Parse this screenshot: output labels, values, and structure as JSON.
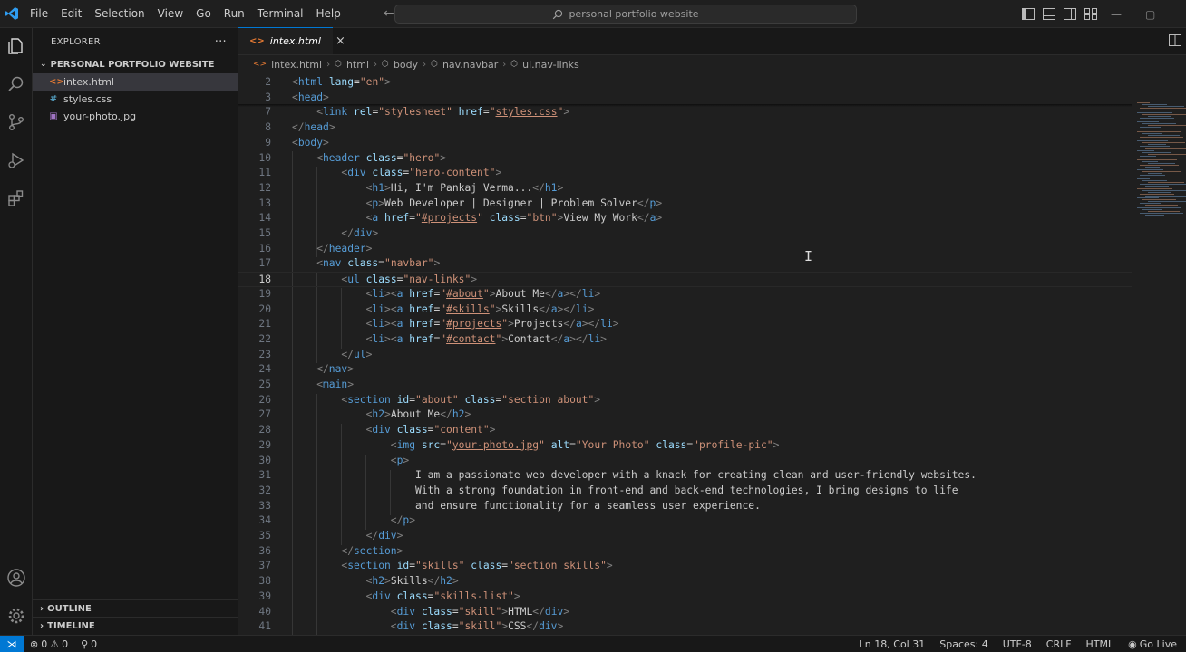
{
  "titlebar": {
    "menu": [
      "File",
      "Edit",
      "Selection",
      "View",
      "Go",
      "Run",
      "Terminal",
      "Help"
    ],
    "search_text": "personal portfolio website",
    "accent": "#0078d4"
  },
  "sidebar": {
    "title": "EXPLORER",
    "more": "···",
    "folder": "PERSONAL PORTFOLIO WEBSITE",
    "files": [
      {
        "name": "intex.html",
        "icon": "<>",
        "icon_color": "#e37933",
        "active": true
      },
      {
        "name": "styles.css",
        "icon": "#",
        "icon_color": "#519aba",
        "active": false
      },
      {
        "name": "your-photo.jpg",
        "icon": "▣",
        "icon_color": "#a074c4",
        "active": false
      }
    ],
    "sections": [
      "OUTLINE",
      "TIMELINE"
    ]
  },
  "editor": {
    "tab": {
      "label": "intex.html",
      "close": "×"
    },
    "breadcrumb": [
      "intex.html",
      "html",
      "body",
      "nav.navbar",
      "ul.nav-links"
    ],
    "current_line": "18",
    "lines": [
      {
        "n": "2",
        "i": 0,
        "t": [
          [
            "b",
            "<"
          ],
          [
            "t",
            "html"
          ],
          [
            "a",
            " lang"
          ],
          [
            "x",
            "="
          ],
          [
            "s",
            "\"en\""
          ],
          [
            "b",
            ">"
          ]
        ]
      },
      {
        "n": "3",
        "i": 0,
        "t": [
          [
            "b",
            "<"
          ],
          [
            "t",
            "head"
          ],
          [
            "b",
            ">"
          ]
        ]
      },
      {
        "n": "7",
        "i": 1,
        "t": [
          [
            "b",
            "<"
          ],
          [
            "t",
            "link"
          ],
          [
            "a",
            " rel"
          ],
          [
            "x",
            "="
          ],
          [
            "s",
            "\"stylesheet\""
          ],
          [
            "a",
            " href"
          ],
          [
            "x",
            "="
          ],
          [
            "s",
            "\""
          ],
          [
            "su",
            "styles.css"
          ],
          [
            "s",
            "\""
          ],
          [
            "b",
            ">"
          ]
        ]
      },
      {
        "n": "8",
        "i": 0,
        "t": [
          [
            "b",
            "</"
          ],
          [
            "t",
            "head"
          ],
          [
            "b",
            ">"
          ]
        ]
      },
      {
        "n": "9",
        "i": 0,
        "t": [
          [
            "b",
            "<"
          ],
          [
            "t",
            "body"
          ],
          [
            "b",
            ">"
          ]
        ]
      },
      {
        "n": "10",
        "i": 1,
        "t": [
          [
            "b",
            "<"
          ],
          [
            "t",
            "header"
          ],
          [
            "a",
            " class"
          ],
          [
            "x",
            "="
          ],
          [
            "s",
            "\"hero\""
          ],
          [
            "b",
            ">"
          ]
        ]
      },
      {
        "n": "11",
        "i": 2,
        "t": [
          [
            "b",
            "<"
          ],
          [
            "t",
            "div"
          ],
          [
            "a",
            " class"
          ],
          [
            "x",
            "="
          ],
          [
            "s",
            "\"hero-content\""
          ],
          [
            "b",
            ">"
          ]
        ]
      },
      {
        "n": "12",
        "i": 3,
        "t": [
          [
            "b",
            "<"
          ],
          [
            "t",
            "h1"
          ],
          [
            "b",
            ">"
          ],
          [
            "x",
            "Hi, I'm Pankaj Verma..."
          ],
          [
            "b",
            "</"
          ],
          [
            "t",
            "h1"
          ],
          [
            "b",
            ">"
          ]
        ]
      },
      {
        "n": "13",
        "i": 3,
        "t": [
          [
            "b",
            "<"
          ],
          [
            "t",
            "p"
          ],
          [
            "b",
            ">"
          ],
          [
            "x",
            "Web Developer | Designer | Problem Solver"
          ],
          [
            "b",
            "</"
          ],
          [
            "t",
            "p"
          ],
          [
            "b",
            ">"
          ]
        ]
      },
      {
        "n": "14",
        "i": 3,
        "t": [
          [
            "b",
            "<"
          ],
          [
            "t",
            "a"
          ],
          [
            "a",
            " href"
          ],
          [
            "x",
            "="
          ],
          [
            "s",
            "\""
          ],
          [
            "su",
            "#projects"
          ],
          [
            "s",
            "\""
          ],
          [
            "a",
            " class"
          ],
          [
            "x",
            "="
          ],
          [
            "s",
            "\"btn\""
          ],
          [
            "b",
            ">"
          ],
          [
            "x",
            "View My Work"
          ],
          [
            "b",
            "</"
          ],
          [
            "t",
            "a"
          ],
          [
            "b",
            ">"
          ]
        ]
      },
      {
        "n": "15",
        "i": 2,
        "t": [
          [
            "b",
            "</"
          ],
          [
            "t",
            "div"
          ],
          [
            "b",
            ">"
          ]
        ]
      },
      {
        "n": "16",
        "i": 1,
        "t": [
          [
            "b",
            "</"
          ],
          [
            "t",
            "header"
          ],
          [
            "b",
            ">"
          ]
        ]
      },
      {
        "n": "17",
        "i": 1,
        "t": [
          [
            "b",
            "<"
          ],
          [
            "t",
            "nav"
          ],
          [
            "a",
            " class"
          ],
          [
            "x",
            "="
          ],
          [
            "s",
            "\"navbar\""
          ],
          [
            "b",
            ">"
          ]
        ]
      },
      {
        "n": "18",
        "i": 2,
        "t": [
          [
            "b",
            "<"
          ],
          [
            "t",
            "ul"
          ],
          [
            "a",
            " class"
          ],
          [
            "x",
            "="
          ],
          [
            "s",
            "\"nav-links\""
          ],
          [
            "b",
            ">"
          ]
        ]
      },
      {
        "n": "19",
        "i": 3,
        "t": [
          [
            "b",
            "<"
          ],
          [
            "t",
            "li"
          ],
          [
            "b",
            "><"
          ],
          [
            "t",
            "a"
          ],
          [
            "a",
            " href"
          ],
          [
            "x",
            "="
          ],
          [
            "s",
            "\""
          ],
          [
            "su",
            "#about"
          ],
          [
            "s",
            "\""
          ],
          [
            "b",
            ">"
          ],
          [
            "x",
            "About Me"
          ],
          [
            "b",
            "</"
          ],
          [
            "t",
            "a"
          ],
          [
            "b",
            "></"
          ],
          [
            "t",
            "li"
          ],
          [
            "b",
            ">"
          ]
        ]
      },
      {
        "n": "20",
        "i": 3,
        "t": [
          [
            "b",
            "<"
          ],
          [
            "t",
            "li"
          ],
          [
            "b",
            "><"
          ],
          [
            "t",
            "a"
          ],
          [
            "a",
            " href"
          ],
          [
            "x",
            "="
          ],
          [
            "s",
            "\""
          ],
          [
            "su",
            "#skills"
          ],
          [
            "s",
            "\""
          ],
          [
            "b",
            ">"
          ],
          [
            "x",
            "Skills"
          ],
          [
            "b",
            "</"
          ],
          [
            "t",
            "a"
          ],
          [
            "b",
            "></"
          ],
          [
            "t",
            "li"
          ],
          [
            "b",
            ">"
          ]
        ]
      },
      {
        "n": "21",
        "i": 3,
        "t": [
          [
            "b",
            "<"
          ],
          [
            "t",
            "li"
          ],
          [
            "b",
            "><"
          ],
          [
            "t",
            "a"
          ],
          [
            "a",
            " href"
          ],
          [
            "x",
            "="
          ],
          [
            "s",
            "\""
          ],
          [
            "su",
            "#projects"
          ],
          [
            "s",
            "\""
          ],
          [
            "b",
            ">"
          ],
          [
            "x",
            "Projects"
          ],
          [
            "b",
            "</"
          ],
          [
            "t",
            "a"
          ],
          [
            "b",
            "></"
          ],
          [
            "t",
            "li"
          ],
          [
            "b",
            ">"
          ]
        ]
      },
      {
        "n": "22",
        "i": 3,
        "t": [
          [
            "b",
            "<"
          ],
          [
            "t",
            "li"
          ],
          [
            "b",
            "><"
          ],
          [
            "t",
            "a"
          ],
          [
            "a",
            " href"
          ],
          [
            "x",
            "="
          ],
          [
            "s",
            "\""
          ],
          [
            "su",
            "#contact"
          ],
          [
            "s",
            "\""
          ],
          [
            "b",
            ">"
          ],
          [
            "x",
            "Contact"
          ],
          [
            "b",
            "</"
          ],
          [
            "t",
            "a"
          ],
          [
            "b",
            "></"
          ],
          [
            "t",
            "li"
          ],
          [
            "b",
            ">"
          ]
        ]
      },
      {
        "n": "23",
        "i": 2,
        "t": [
          [
            "b",
            "</"
          ],
          [
            "t",
            "ul"
          ],
          [
            "b",
            ">"
          ]
        ]
      },
      {
        "n": "24",
        "i": 1,
        "t": [
          [
            "b",
            "</"
          ],
          [
            "t",
            "nav"
          ],
          [
            "b",
            ">"
          ]
        ]
      },
      {
        "n": "25",
        "i": 1,
        "t": [
          [
            "b",
            "<"
          ],
          [
            "t",
            "main"
          ],
          [
            "b",
            ">"
          ]
        ]
      },
      {
        "n": "26",
        "i": 2,
        "t": [
          [
            "b",
            "<"
          ],
          [
            "t",
            "section"
          ],
          [
            "a",
            " id"
          ],
          [
            "x",
            "="
          ],
          [
            "s",
            "\"about\""
          ],
          [
            "a",
            " class"
          ],
          [
            "x",
            "="
          ],
          [
            "s",
            "\"section about\""
          ],
          [
            "b",
            ">"
          ]
        ]
      },
      {
        "n": "27",
        "i": 3,
        "t": [
          [
            "b",
            "<"
          ],
          [
            "t",
            "h2"
          ],
          [
            "b",
            ">"
          ],
          [
            "x",
            "About Me"
          ],
          [
            "b",
            "</"
          ],
          [
            "t",
            "h2"
          ],
          [
            "b",
            ">"
          ]
        ]
      },
      {
        "n": "28",
        "i": 3,
        "t": [
          [
            "b",
            "<"
          ],
          [
            "t",
            "div"
          ],
          [
            "a",
            " class"
          ],
          [
            "x",
            "="
          ],
          [
            "s",
            "\"content\""
          ],
          [
            "b",
            ">"
          ]
        ]
      },
      {
        "n": "29",
        "i": 4,
        "t": [
          [
            "b",
            "<"
          ],
          [
            "t",
            "img"
          ],
          [
            "a",
            " src"
          ],
          [
            "x",
            "="
          ],
          [
            "s",
            "\""
          ],
          [
            "su",
            "your-photo.jpg"
          ],
          [
            "s",
            "\""
          ],
          [
            "a",
            " alt"
          ],
          [
            "x",
            "="
          ],
          [
            "s",
            "\"Your Photo\""
          ],
          [
            "a",
            " class"
          ],
          [
            "x",
            "="
          ],
          [
            "s",
            "\"profile-pic\""
          ],
          [
            "b",
            ">"
          ]
        ]
      },
      {
        "n": "30",
        "i": 4,
        "t": [
          [
            "b",
            "<"
          ],
          [
            "t",
            "p"
          ],
          [
            "b",
            ">"
          ]
        ]
      },
      {
        "n": "31",
        "i": 5,
        "t": [
          [
            "x",
            "I am a passionate web developer with a knack for creating clean and user-friendly websites."
          ]
        ]
      },
      {
        "n": "32",
        "i": 5,
        "t": [
          [
            "x",
            "With a strong foundation in front-end and back-end technologies, I bring designs to life"
          ]
        ]
      },
      {
        "n": "33",
        "i": 5,
        "t": [
          [
            "x",
            "and ensure functionality for a seamless user experience."
          ]
        ]
      },
      {
        "n": "34",
        "i": 4,
        "t": [
          [
            "b",
            "</"
          ],
          [
            "t",
            "p"
          ],
          [
            "b",
            ">"
          ]
        ]
      },
      {
        "n": "35",
        "i": 3,
        "t": [
          [
            "b",
            "</"
          ],
          [
            "t",
            "div"
          ],
          [
            "b",
            ">"
          ]
        ]
      },
      {
        "n": "36",
        "i": 2,
        "t": [
          [
            "b",
            "</"
          ],
          [
            "t",
            "section"
          ],
          [
            "b",
            ">"
          ]
        ]
      },
      {
        "n": "37",
        "i": 2,
        "t": [
          [
            "b",
            "<"
          ],
          [
            "t",
            "section"
          ],
          [
            "a",
            " id"
          ],
          [
            "x",
            "="
          ],
          [
            "s",
            "\"skills\""
          ],
          [
            "a",
            " class"
          ],
          [
            "x",
            "="
          ],
          [
            "s",
            "\"section skills\""
          ],
          [
            "b",
            ">"
          ]
        ]
      },
      {
        "n": "38",
        "i": 3,
        "t": [
          [
            "b",
            "<"
          ],
          [
            "t",
            "h2"
          ],
          [
            "b",
            ">"
          ],
          [
            "x",
            "Skills"
          ],
          [
            "b",
            "</"
          ],
          [
            "t",
            "h2"
          ],
          [
            "b",
            ">"
          ]
        ]
      },
      {
        "n": "39",
        "i": 3,
        "t": [
          [
            "b",
            "<"
          ],
          [
            "t",
            "div"
          ],
          [
            "a",
            " class"
          ],
          [
            "x",
            "="
          ],
          [
            "s",
            "\"skills-list\""
          ],
          [
            "b",
            ">"
          ]
        ]
      },
      {
        "n": "40",
        "i": 4,
        "t": [
          [
            "b",
            "<"
          ],
          [
            "t",
            "div"
          ],
          [
            "a",
            " class"
          ],
          [
            "x",
            "="
          ],
          [
            "s",
            "\"skill\""
          ],
          [
            "b",
            ">"
          ],
          [
            "x",
            "HTML"
          ],
          [
            "b",
            "</"
          ],
          [
            "t",
            "div"
          ],
          [
            "b",
            ">"
          ]
        ]
      },
      {
        "n": "41",
        "i": 4,
        "t": [
          [
            "b",
            "<"
          ],
          [
            "t",
            "div"
          ],
          [
            "a",
            " class"
          ],
          [
            "x",
            "="
          ],
          [
            "s",
            "\"skill\""
          ],
          [
            "b",
            ">"
          ],
          [
            "x",
            "CSS"
          ],
          [
            "b",
            "</"
          ],
          [
            "t",
            "div"
          ],
          [
            "b",
            ">"
          ]
        ]
      }
    ]
  },
  "statusbar": {
    "errors": "0",
    "warnings": "0",
    "ports": "0",
    "position": "Ln 18, Col 31",
    "spaces": "Spaces: 4",
    "encoding": "UTF-8",
    "eol": "CRLF",
    "language": "HTML",
    "golive": "Go Live"
  }
}
